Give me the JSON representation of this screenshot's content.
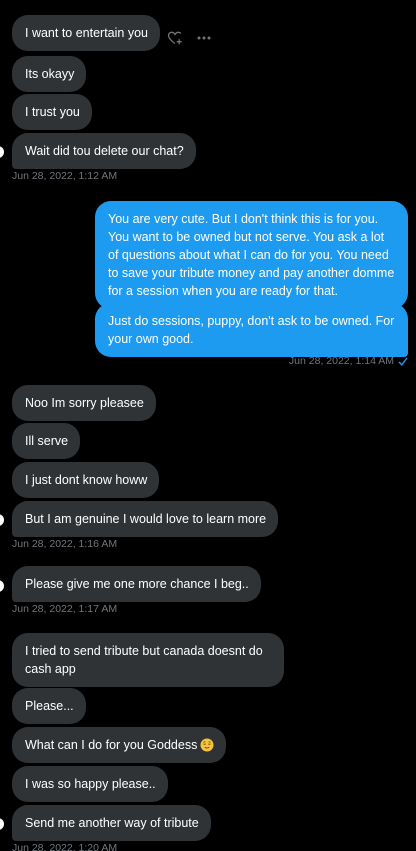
{
  "conversation": {
    "messages": [
      {
        "side": "in",
        "text": "I want to entertain you"
      },
      {
        "side": "in",
        "text": "Its okayy"
      },
      {
        "side": "in",
        "text": "I trust you"
      },
      {
        "side": "in",
        "text": "Wait did tou delete our chat?"
      },
      {
        "side": "out",
        "text": "You are very cute. But I don't think this is for you. You want to be owned but not serve. You ask a lot of questions about what I can do for you. You need to save your tribute money and pay another domme for a session when you are ready for that."
      },
      {
        "side": "out",
        "text": "Just do sessions, puppy, don't ask to be owned. For your own good."
      },
      {
        "side": "in",
        "text": "Noo Im sorry pleasee"
      },
      {
        "side": "in",
        "text": "Ill serve"
      },
      {
        "side": "in",
        "text": "I just dont know howw"
      },
      {
        "side": "in",
        "text": "But I am genuine I would love to learn more"
      },
      {
        "side": "in",
        "text": "Please give me one more chance I beg.."
      },
      {
        "side": "in",
        "text": "I tried to send tribute but canada doesnt do cash app"
      },
      {
        "side": "in",
        "text": "Please..."
      },
      {
        "side": "in",
        "text": "What can I do for you Goddess",
        "emoji": "relieved-face"
      },
      {
        "side": "in",
        "text": "I was so happy please.."
      },
      {
        "side": "in",
        "text": "Send me another way of tribute"
      }
    ],
    "timestamps": [
      "Jun 28, 2022, 1:12 AM",
      "Jun 28, 2022, 1:14 AM",
      "Jun 28, 2022, 1:16 AM",
      "Jun 28, 2022, 1:17 AM",
      "Jun 28, 2022, 1:20 AM"
    ]
  },
  "colors": {
    "background": "#000000",
    "incoming_bubble": "#2f3336",
    "outgoing_bubble": "#1d9bf0",
    "timestamp": "#71767b"
  },
  "icons": {
    "react": "heart-plus-icon",
    "more": "more-horizontal-icon",
    "read": "checkmark-icon"
  }
}
